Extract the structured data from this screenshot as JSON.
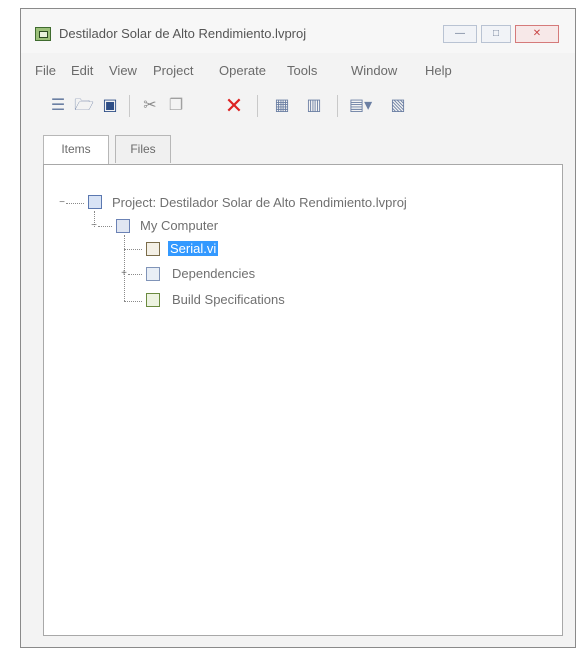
{
  "window": {
    "title": "Destilador Solar de Alto Rendimiento.lvproj",
    "controls": [
      "—",
      "□",
      "✕"
    ]
  },
  "menu": [
    "File",
    "Edit",
    "View",
    "Project",
    "Operate",
    "Tools",
    "Window",
    "Help"
  ],
  "toolbar": {
    "icons": [
      "new-icon",
      "open-icon",
      "save-icon",
      "cut-icon",
      "copy-icon",
      "delete-icon",
      "add-icon",
      "organize-icon",
      "view-icon",
      "properties-icon"
    ]
  },
  "tabs": [
    {
      "label": "Items"
    },
    {
      "label": "Files"
    }
  ],
  "tree": {
    "project": "Project: Destilador Solar de Alto Rendimiento.lvproj",
    "computer": "My Computer",
    "children": [
      {
        "label": "Serial.vi",
        "selected": true
      },
      {
        "label": "Dependencies"
      },
      {
        "label": "Build Specifications"
      }
    ]
  },
  "colors": {
    "selection": "#3399ff",
    "close_button": "#c94545"
  }
}
